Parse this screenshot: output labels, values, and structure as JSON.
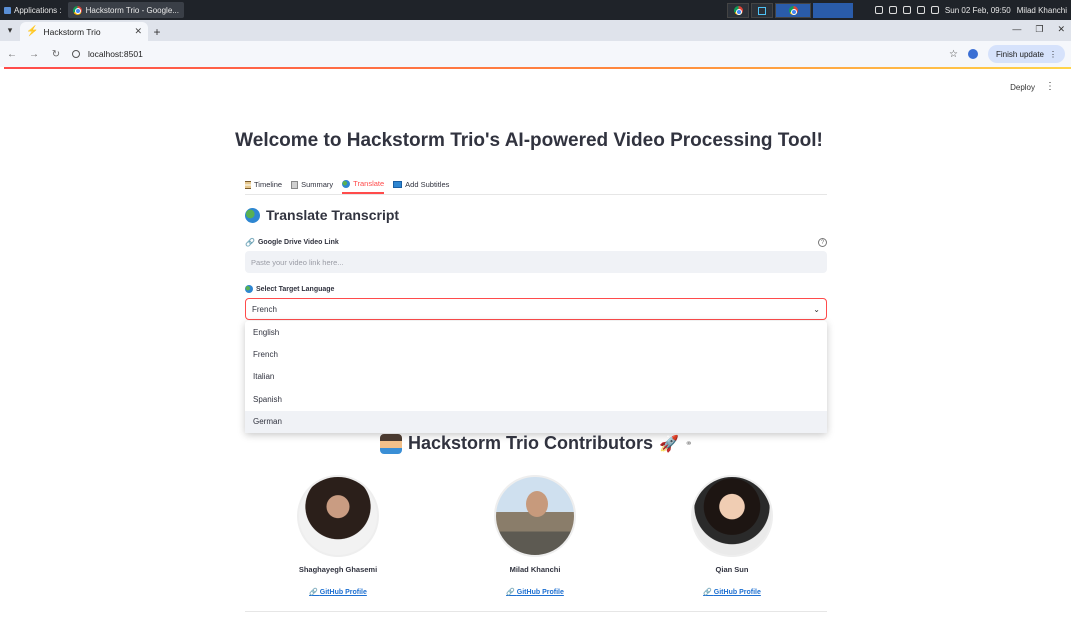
{
  "os": {
    "apps_label": "Applications :",
    "task_label": "Hackstorm Trio - Google...",
    "clock": "Sun 02 Feb, 09:50",
    "user": "Milad Khanchi"
  },
  "browser": {
    "tab_title": "Hackstorm Trio",
    "url": "localhost:8501",
    "finish_update_label": "Finish update"
  },
  "app": {
    "deploy_label": "Deploy",
    "title": "Welcome to Hackstorm Trio's AI-powered Video Processing Tool!",
    "tabs": [
      {
        "label": "Timeline",
        "icon": "hourglass-icon"
      },
      {
        "label": "Summary",
        "icon": "notepad-icon"
      },
      {
        "label": "Translate",
        "icon": "globe-icon",
        "active": true
      },
      {
        "label": "Add Subtitles",
        "icon": "tv-icon"
      }
    ],
    "section_title": "Translate Transcript",
    "link_label": "Google Drive Video Link",
    "link_placeholder": "Paste your video link here...",
    "language_label": "Select Target Language",
    "language_value": "French",
    "language_options": [
      "English",
      "French",
      "Italian",
      "Spanish",
      "German"
    ],
    "contributors_title": "Hackstorm Trio Contributors",
    "contributors": [
      {
        "name": "Shaghayegh Ghasemi",
        "link": "GitHub Profile"
      },
      {
        "name": "Milad Khanchi",
        "link": "GitHub Profile"
      },
      {
        "name": "Qian Sun",
        "link": "GitHub Profile"
      }
    ]
  },
  "colors": {
    "accent": "#ff4b4b",
    "link": "#1c6fd1",
    "text": "#31333f"
  }
}
